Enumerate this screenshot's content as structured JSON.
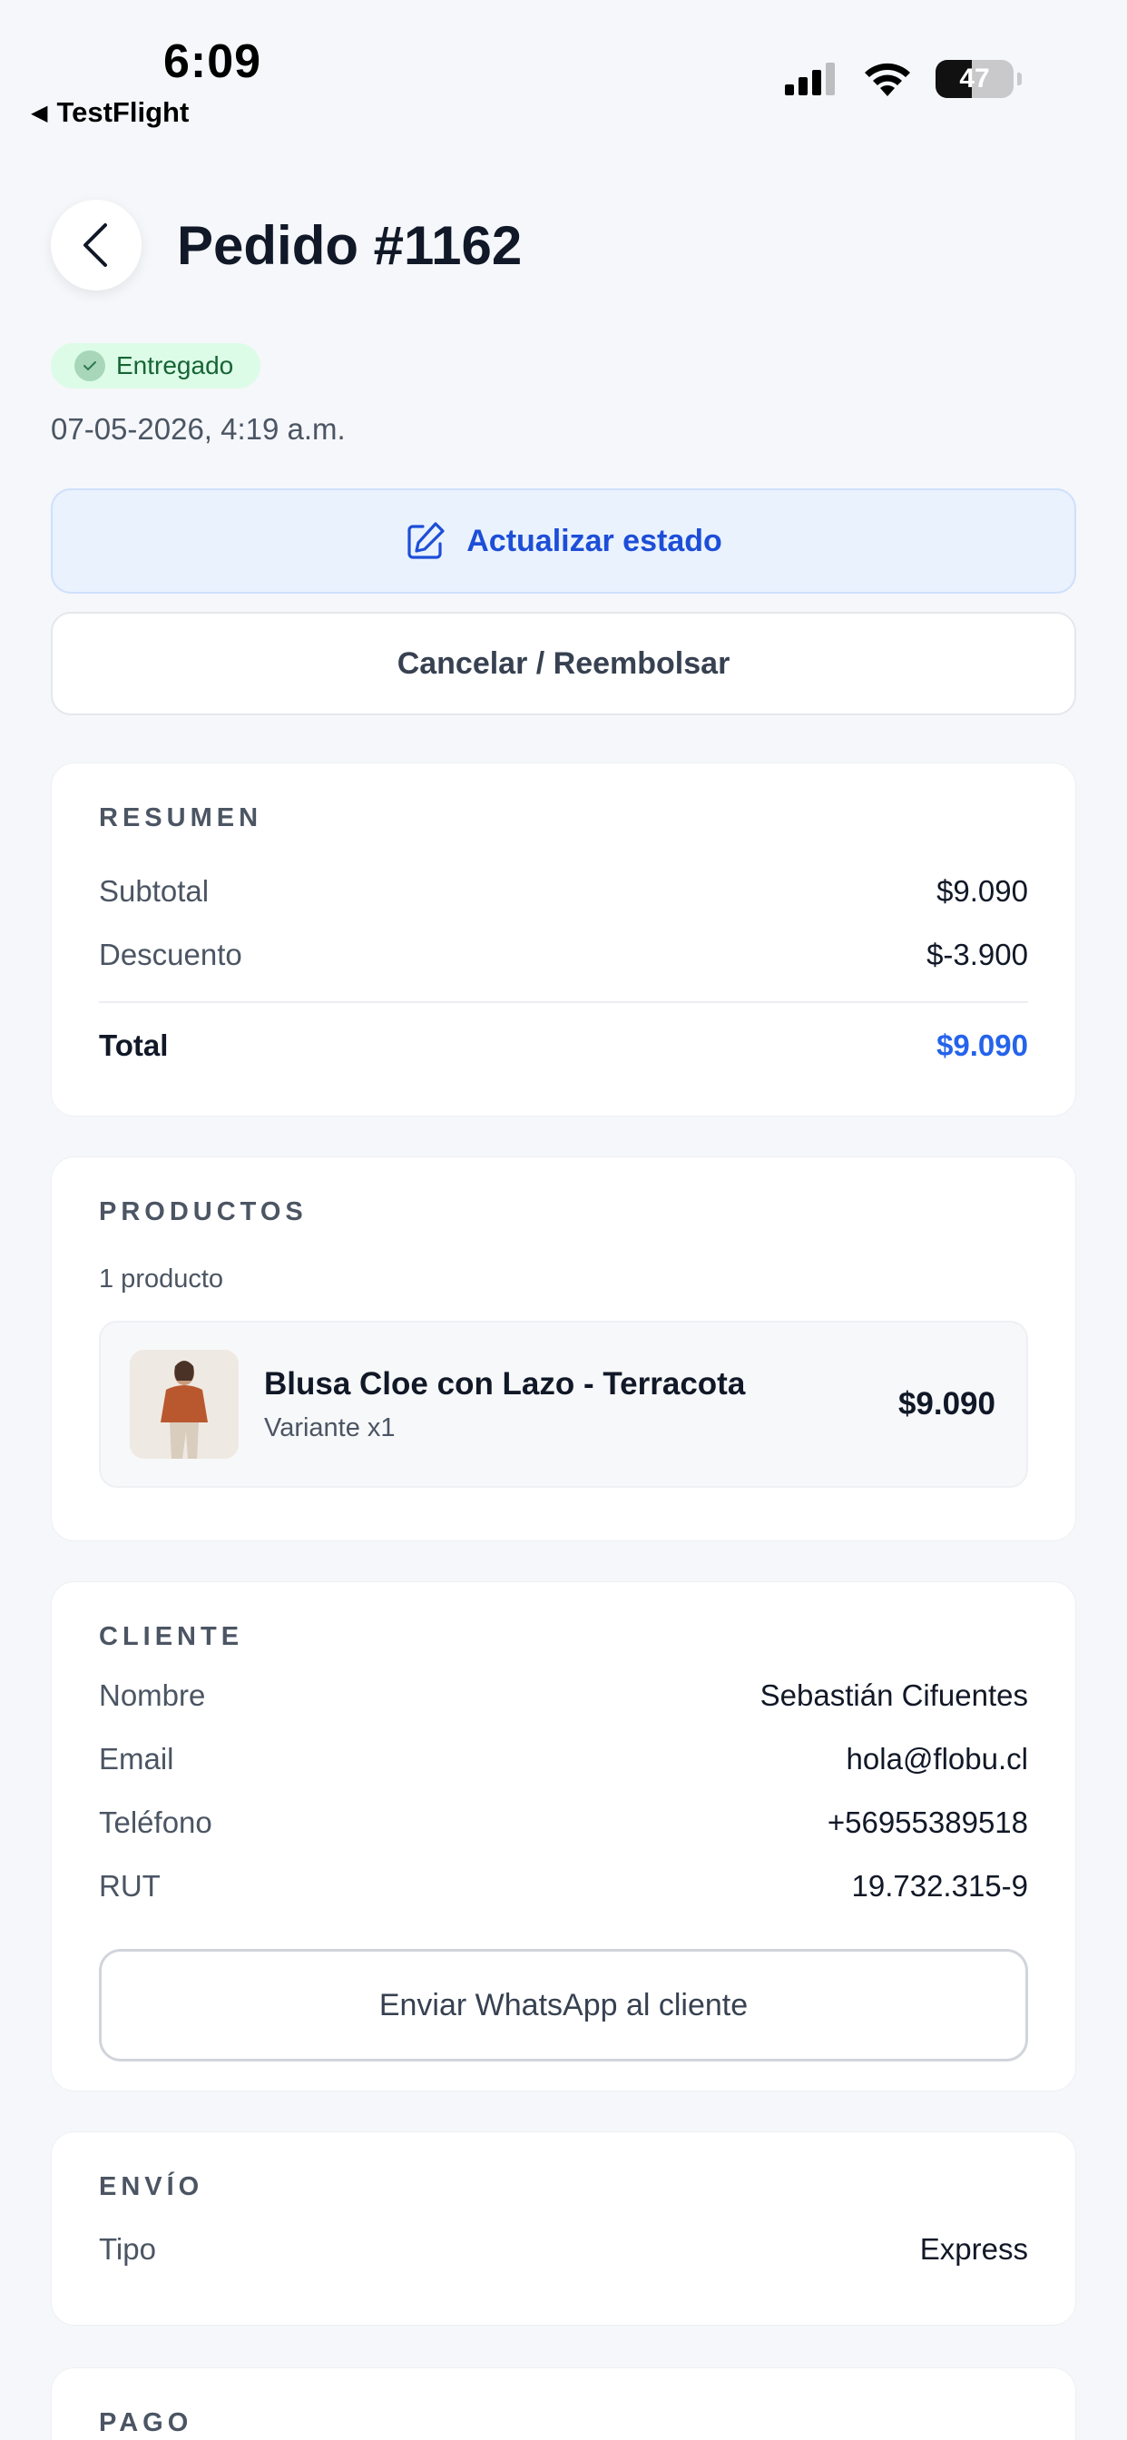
{
  "status_bar": {
    "time": "6:09",
    "back_app": "TestFlight",
    "battery": "47",
    "battery_level": 0.47
  },
  "header": {
    "title": "Pedido #1162"
  },
  "order": {
    "status": "Entregado",
    "date": "07-05-2026, 4:19 a.m."
  },
  "actions": {
    "update_status": "Actualizar estado",
    "cancel_refund": "Cancelar / Reembolsar"
  },
  "summary": {
    "title": "RESUMEN",
    "rows": [
      {
        "label": "Subtotal",
        "value": "$9.090"
      },
      {
        "label": "Descuento",
        "value": "$-3.900"
      }
    ],
    "total_label": "Total",
    "total_value": "$9.090"
  },
  "products": {
    "title": "PRODUCTOS",
    "count": "1 producto",
    "items": [
      {
        "name": "Blusa Cloe con Lazo - Terracota",
        "variant": "Variante x1",
        "price": "$9.090"
      }
    ]
  },
  "client": {
    "title": "CLIENTE",
    "rows": [
      {
        "label": "Nombre",
        "value": "Sebastián Cifuentes"
      },
      {
        "label": "Email",
        "value": "hola@flobu.cl"
      },
      {
        "label": "Teléfono",
        "value": "+56955389518"
      },
      {
        "label": "RUT",
        "value": "19.732.315-9"
      }
    ],
    "whatsapp_button": "Enviar WhatsApp al cliente"
  },
  "shipping": {
    "title": "ENVÍO",
    "rows": [
      {
        "label": "Tipo",
        "value": "Express"
      }
    ]
  },
  "payment": {
    "title": "PAGO"
  },
  "colors": {
    "accent": "#2563eb",
    "success_bg": "#dcfce7",
    "success_text": "#166534",
    "background": "#f5f7fa"
  }
}
